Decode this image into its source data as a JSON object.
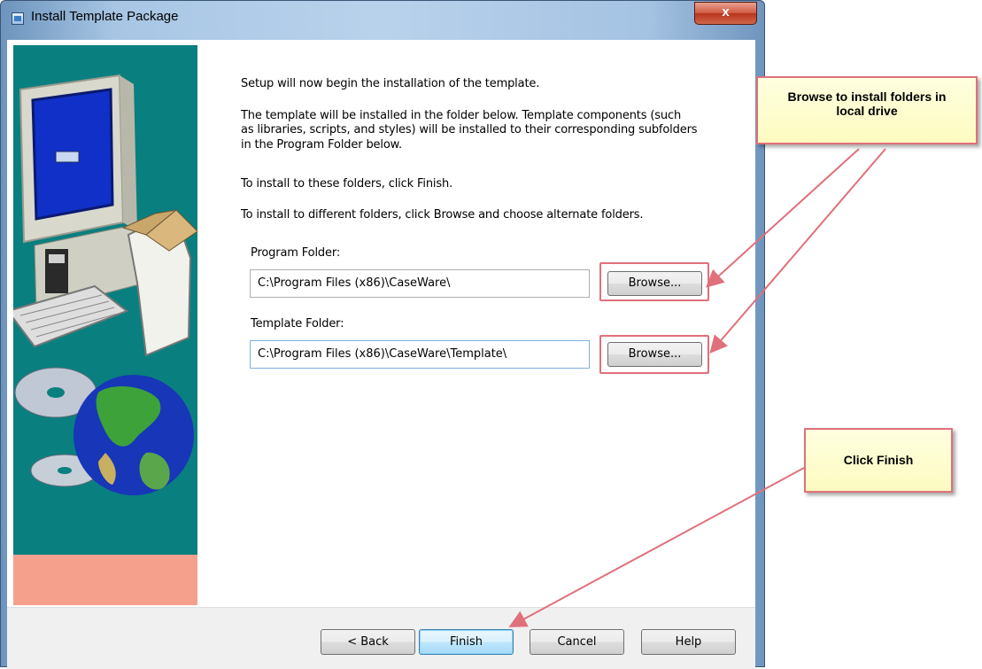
{
  "window": {
    "title": "Install Template Package",
    "close_label": "x"
  },
  "content": {
    "intro": "Setup will now begin the installation of the template.",
    "description_line1": "The template will be installed in the folder below.  Template components (such",
    "description_line2": "as libraries, scripts, and styles) will be installed to their corresponding subfolders",
    "description_line3": "in the Program Folder below.",
    "finish_instruction": "To install to these folders, click Finish.",
    "browse_instruction": "To install to different folders, click Browse and choose alternate folders.",
    "program_folder": {
      "label": "Program Folder:",
      "value": "C:\\Program Files (x86)\\CaseWare\\",
      "browse_label": "Browse..."
    },
    "template_folder": {
      "label": "Template Folder:",
      "value": "C:\\Program Files (x86)\\CaseWare\\Template\\",
      "browse_label": "Browse..."
    }
  },
  "footer": {
    "back_label": "< Back",
    "finish_label": "Finish",
    "cancel_label": "Cancel",
    "help_label": "Help"
  },
  "callouts": {
    "browse_line1": "Browse to install folders in",
    "browse_line2": "local drive",
    "finish": "Click Finish"
  },
  "colors": {
    "art_panel": "#0a7f7f",
    "art_accent": "#f5a08d",
    "annotation_border": "#e0707a",
    "callout_fill": "#fdfbc0"
  }
}
